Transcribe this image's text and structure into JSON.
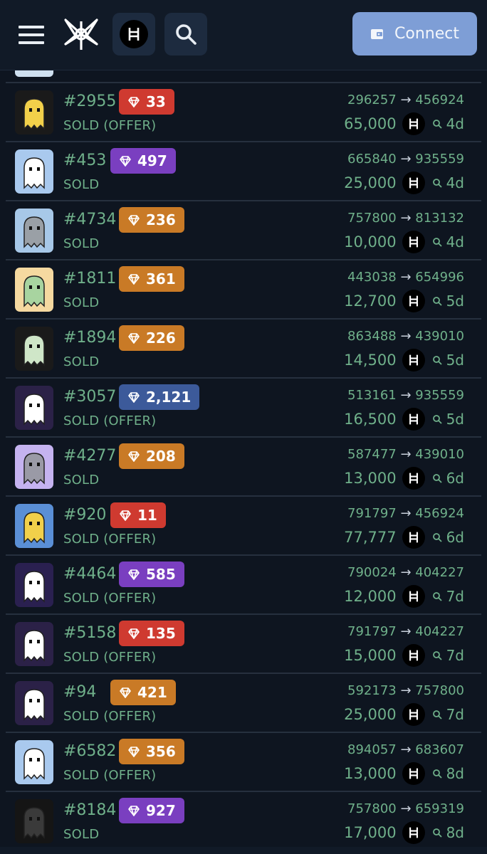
{
  "header": {
    "connect_label": "Connect"
  },
  "colors": {
    "badge_red": "#cf3a30",
    "badge_purple": "#7a3fc0",
    "badge_orange": "#c97a26",
    "badge_blue": "#3c5a9a",
    "text_green": "#6fb08a"
  },
  "icons": [
    "menu-icon",
    "logo-icon",
    "hbar-icon",
    "search-icon",
    "wallet-icon",
    "diamond-icon",
    "magnifier-icon"
  ],
  "sales": [
    {
      "id": "#2955",
      "rank": "33",
      "rank_color": "#cf3a30",
      "status": "SOLD (OFFER)",
      "from": "296257",
      "to": "456924",
      "price": "65,000",
      "age": "4d",
      "thumb_bg": "#1a1a1a",
      "char": "#f2d04a"
    },
    {
      "id": "#453",
      "rank": "497",
      "rank_color": "#7a3fc0",
      "status": "SOLD",
      "from": "665840",
      "to": "935559",
      "price": "25,000",
      "age": "4d",
      "thumb_bg": "#a9c9ee",
      "char": "#ffffff"
    },
    {
      "id": "#4734",
      "rank": "236",
      "rank_color": "#c97a26",
      "status": "SOLD",
      "from": "757800",
      "to": "813132",
      "price": "10,000",
      "age": "4d",
      "thumb_bg": "#a7c8e8",
      "char": "#9aa0a6"
    },
    {
      "id": "#1811",
      "rank": "361",
      "rank_color": "#c97a26",
      "status": "SOLD",
      "from": "443038",
      "to": "654996",
      "price": "12,700",
      "age": "5d",
      "thumb_bg": "#f5d9a0",
      "char": "#a8d4a0"
    },
    {
      "id": "#1894",
      "rank": "226",
      "rank_color": "#c97a26",
      "status": "SOLD",
      "from": "863488",
      "to": "439010",
      "price": "14,500",
      "age": "5d",
      "thumb_bg": "#1a1a1a",
      "char": "#cfe6c8"
    },
    {
      "id": "#3057",
      "rank": "2,121",
      "rank_color": "#3c5a9a",
      "status": "SOLD (OFFER)",
      "from": "513161",
      "to": "935559",
      "price": "16,500",
      "age": "5d",
      "thumb_bg": "#2b2147",
      "char": "#ffffff"
    },
    {
      "id": "#4277",
      "rank": "208",
      "rank_color": "#c97a26",
      "status": "SOLD",
      "from": "587477",
      "to": "439010",
      "price": "13,000",
      "age": "6d",
      "thumb_bg": "#c5b3f0",
      "char": "#9a9aa6"
    },
    {
      "id": "#920",
      "rank": "11",
      "rank_color": "#cf3a30",
      "status": "SOLD (OFFER)",
      "from": "791797",
      "to": "456924",
      "price": "77,777",
      "age": "6d",
      "thumb_bg": "#5a8fd6",
      "char": "#f2d04a"
    },
    {
      "id": "#4464",
      "rank": "585",
      "rank_color": "#7a3fc0",
      "status": "SOLD (OFFER)",
      "from": "790024",
      "to": "404227",
      "price": "12,000",
      "age": "7d",
      "thumb_bg": "#2a2050",
      "char": "#ffffff"
    },
    {
      "id": "#5158",
      "rank": "135",
      "rank_color": "#cf3a30",
      "status": "SOLD (OFFER)",
      "from": "791797",
      "to": "404227",
      "price": "15,000",
      "age": "7d",
      "thumb_bg": "#2b2147",
      "char": "#ffffff"
    },
    {
      "id": "#94",
      "rank": "421",
      "rank_color": "#c97a26",
      "status": "SOLD (OFFER)",
      "from": "592173",
      "to": "757800",
      "price": "25,000",
      "age": "7d",
      "thumb_bg": "#2b2147",
      "char": "#ffffff"
    },
    {
      "id": "#6582",
      "rank": "356",
      "rank_color": "#c97a26",
      "status": "SOLD (OFFER)",
      "from": "894057",
      "to": "683607",
      "price": "13,000",
      "age": "8d",
      "thumb_bg": "#a9c9ee",
      "char": "#ffffff"
    },
    {
      "id": "#8184",
      "rank": "927",
      "rank_color": "#7a3fc0",
      "status": "SOLD",
      "from": "757800",
      "to": "659319",
      "price": "17,000",
      "age": "8d",
      "thumb_bg": "#151515",
      "char": "#3a3a3a"
    }
  ]
}
